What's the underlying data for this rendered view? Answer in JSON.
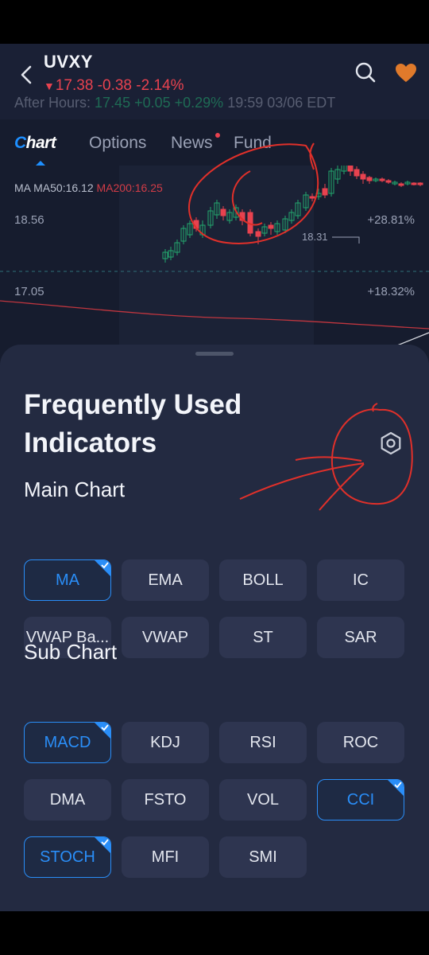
{
  "header": {
    "ticker": "UVXY",
    "price_arrow": "▼",
    "quote": "17.38 -0.38 -2.14%",
    "after_hours_label": "After Hours:",
    "after_hours_gain": "17.45 +0.05 +0.29%",
    "after_hours_time": "19:59 03/06 EDT"
  },
  "tabs": [
    {
      "label": "C",
      "label_rest": "hart"
    },
    {
      "label": "Options"
    },
    {
      "label": "News"
    },
    {
      "label": "Fund"
    }
  ],
  "chart": {
    "ma_label": "MA",
    "ma50": "MA50:16.12",
    "ma200": "MA200:16.25",
    "price_high": "18.56",
    "price_mid": "17.05",
    "pct_high": "+28.81%",
    "pct_mid": "+18.32%",
    "peak_label": "18.31"
  },
  "sheet": {
    "title": "Frequently Used Indicators",
    "main_chart_title": "Main Chart",
    "main_chart": [
      {
        "label": "MA",
        "selected": true
      },
      {
        "label": "EMA",
        "selected": false
      },
      {
        "label": "BOLL",
        "selected": false
      },
      {
        "label": "IC",
        "selected": false
      },
      {
        "label": "VWAP Ba...",
        "selected": false
      },
      {
        "label": "VWAP",
        "selected": false
      },
      {
        "label": "ST",
        "selected": false
      },
      {
        "label": "SAR",
        "selected": false
      }
    ],
    "sub_chart_title": "Sub Chart",
    "sub_chart": [
      {
        "label": "MACD",
        "selected": true
      },
      {
        "label": "KDJ",
        "selected": false
      },
      {
        "label": "RSI",
        "selected": false
      },
      {
        "label": "ROC",
        "selected": false
      },
      {
        "label": "DMA",
        "selected": false
      },
      {
        "label": "FSTO",
        "selected": false
      },
      {
        "label": "VOL",
        "selected": false
      },
      {
        "label": "CCI",
        "selected": true
      },
      {
        "label": "STOCH",
        "selected": true
      },
      {
        "label": "MFI",
        "selected": false
      },
      {
        "label": "SMI",
        "selected": false
      }
    ]
  },
  "colors": {
    "accent": "#2a8ef8",
    "down": "#e8424f",
    "up": "#23a86e",
    "favorite": "#e07a2b",
    "annotation": "#e0302a"
  },
  "icons": [
    "back-chevron-icon",
    "search-icon",
    "heart-icon",
    "gear-icon",
    "check-icon"
  ]
}
